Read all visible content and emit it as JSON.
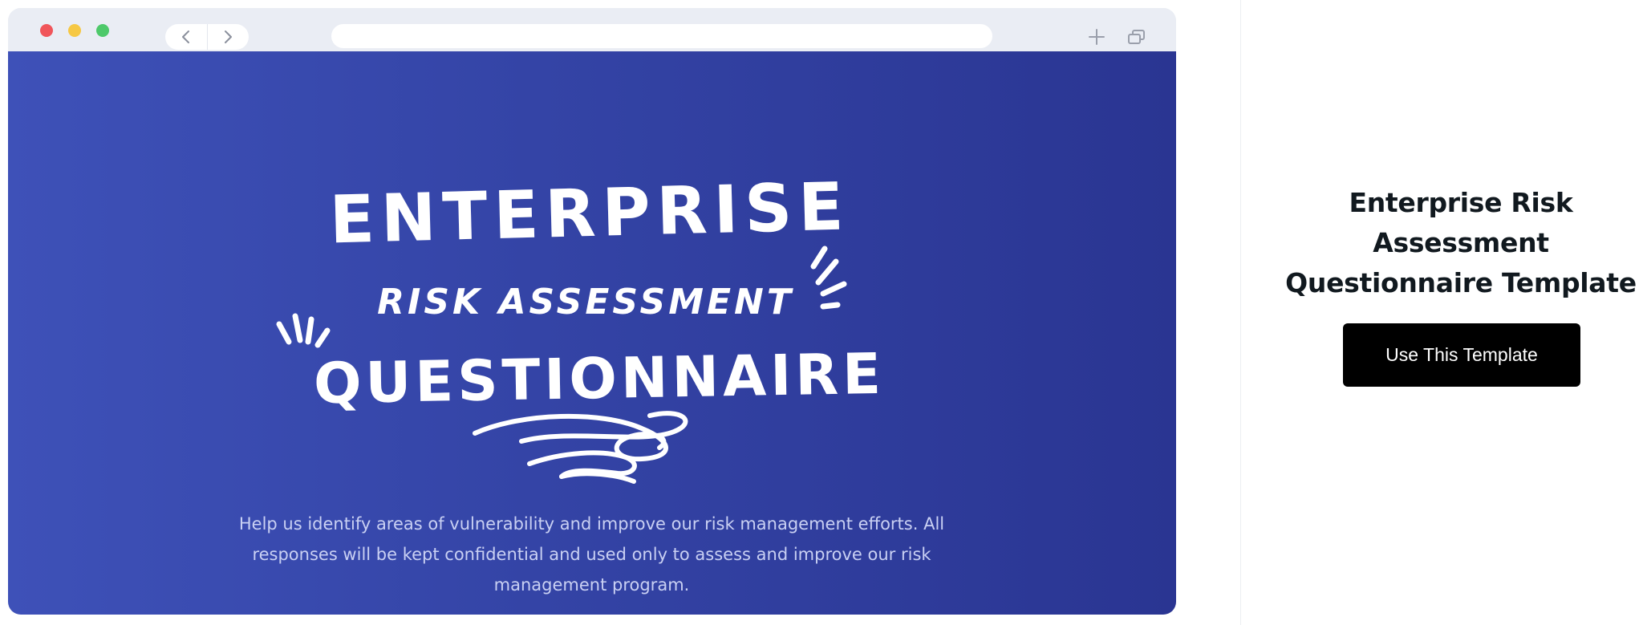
{
  "browser": {
    "url_value": "",
    "icons": [
      "back-icon",
      "forward-icon",
      "new-tab-icon",
      "tabs-icon"
    ]
  },
  "hero": {
    "title_line1": "ENTERPRISE",
    "title_line2": "RISK ASSESSMENT",
    "title_line3": "QUESTIONNAIRE",
    "description": "Help us identify areas of vulnerability and improve our risk management efforts. All responses will be kept confidential and used only to assess and improve our risk management program."
  },
  "sidebar": {
    "title": "Enterprise Risk Assessment Questionnaire Template",
    "cta_label": "Use This Template"
  },
  "colors": {
    "hero_gradient_start": "#3e51b8",
    "hero_gradient_end": "#2a3592",
    "cta_background": "#000000"
  }
}
